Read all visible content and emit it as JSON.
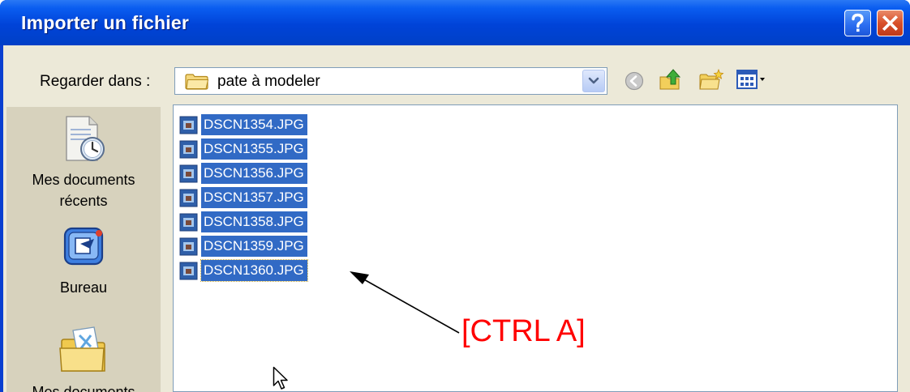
{
  "window": {
    "title": "Importer un fichier"
  },
  "titlebar_buttons": {
    "help_label": "?",
    "close_label": "×"
  },
  "lookin": {
    "label": "Regarder dans :",
    "value": "pate à modeler"
  },
  "toolbar": {
    "icons": [
      "back-icon",
      "up-folder-icon",
      "new-folder-icon",
      "view-menu-icon"
    ]
  },
  "places": [
    {
      "label_line1": "Mes documents",
      "label_line2": "récents",
      "icon": "recent-documents-icon"
    },
    {
      "label_line1": "Bureau",
      "label_line2": "",
      "icon": "desktop-icon"
    },
    {
      "label_line1": "Mes documents",
      "label_line2": "",
      "icon": "my-documents-icon"
    }
  ],
  "files": [
    {
      "name": "DSCN1354.JPG",
      "selected": true
    },
    {
      "name": "DSCN1355.JPG",
      "selected": true
    },
    {
      "name": "DSCN1356.JPG",
      "selected": true
    },
    {
      "name": "DSCN1357.JPG",
      "selected": true
    },
    {
      "name": "DSCN1358.JPG",
      "selected": true
    },
    {
      "name": "DSCN1359.JPG",
      "selected": true
    },
    {
      "name": "DSCN1360.JPG",
      "selected": true,
      "focused": true
    }
  ],
  "annotation": {
    "text": "[CTRL A]",
    "color": "#ff0000"
  },
  "colors": {
    "titlebar": "#0043d8",
    "selection": "#316ac5",
    "dialog_bg": "#ece9d8",
    "places_bg": "#d7d2bd"
  }
}
